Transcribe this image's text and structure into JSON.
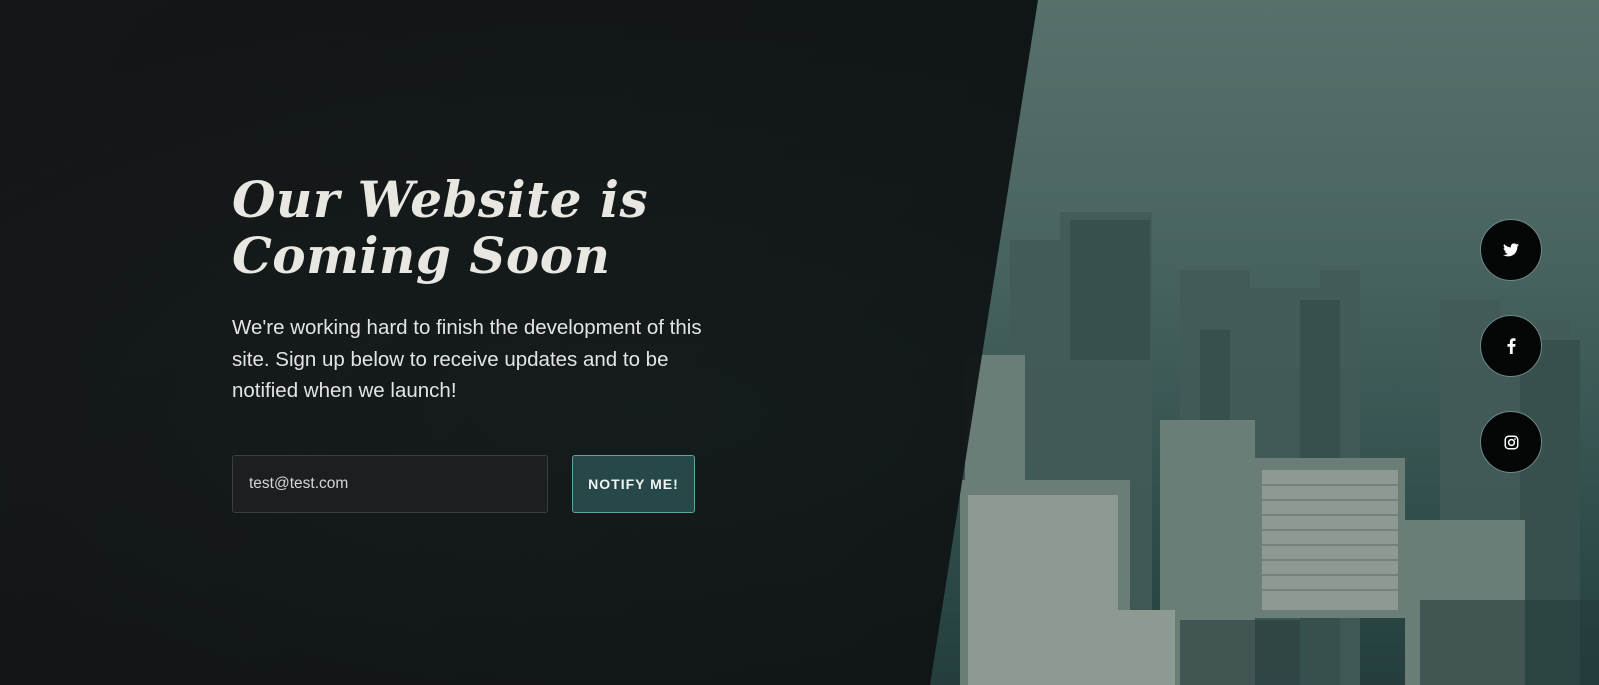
{
  "hero": {
    "title_line1": "Our Website is",
    "title_line2": "Coming Soon",
    "lead": "We're working hard to finish the development of this site. Sign up below to receive updates and to be notified when we launch!"
  },
  "signup": {
    "email_value": "test@test.com",
    "button_label": "NOTIFY ME!"
  },
  "social": [
    {
      "icon": "twitter-icon"
    },
    {
      "icon": "facebook-icon"
    },
    {
      "icon": "instagram-icon"
    }
  ],
  "colors": {
    "panel": "#0e1213",
    "accent_button": "#264848",
    "accent_border": "#5ea4a0"
  }
}
